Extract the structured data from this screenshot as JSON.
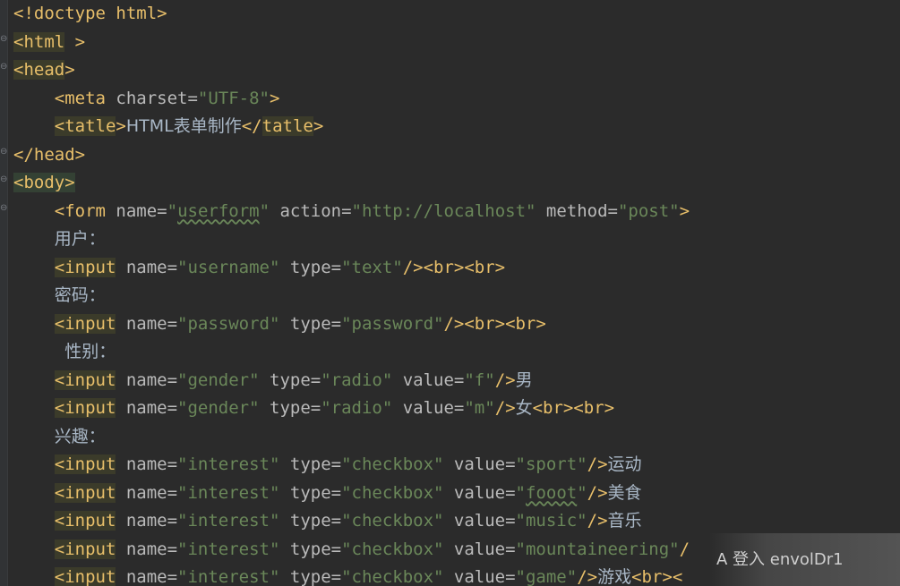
{
  "lines": [
    {
      "indent": "",
      "tokens": [
        {
          "c": "b",
          "t": "<!doctype html>"
        }
      ]
    },
    {
      "indent": "",
      "tokens": [
        {
          "c": "hl",
          "t": "<html"
        },
        {
          "c": "b",
          "t": " >"
        }
      ]
    },
    {
      "indent": "",
      "tokens": [
        {
          "c": "hl",
          "t": "<head"
        },
        {
          "c": "b",
          "t": ">"
        }
      ]
    },
    {
      "indent": "    ",
      "tokens": [
        {
          "c": "b",
          "t": "<meta"
        },
        {
          "c": "a",
          "t": " charset="
        },
        {
          "c": "s",
          "t": "\"UTF-8\""
        },
        {
          "c": "b",
          "t": ">"
        }
      ]
    },
    {
      "indent": "    ",
      "tokens": [
        {
          "c": "hl",
          "t": "<tatle"
        },
        {
          "c": "b",
          "t": ">"
        },
        {
          "c": "t cjk",
          "t": "HTML表单制作"
        },
        {
          "c": "b",
          "t": "</"
        },
        {
          "c": "hl",
          "t": "tatle"
        },
        {
          "c": "b",
          "t": ">"
        }
      ]
    },
    {
      "indent": "",
      "tokens": [
        {
          "c": "b",
          "t": "</head>"
        }
      ]
    },
    {
      "indent": "",
      "tokens": [
        {
          "c": "body-hl",
          "t": "<body>"
        }
      ]
    },
    {
      "indent": "    ",
      "tokens": [
        {
          "c": "b",
          "t": "<form"
        },
        {
          "c": "a",
          "t": " name="
        },
        {
          "c": "s",
          "t": "\""
        },
        {
          "c": "s typo",
          "t": "userform"
        },
        {
          "c": "s",
          "t": "\""
        },
        {
          "c": "a",
          "t": " action="
        },
        {
          "c": "s",
          "t": "\"http://localhost\""
        },
        {
          "c": "a",
          "t": " method="
        },
        {
          "c": "s",
          "t": "\"post\""
        },
        {
          "c": "b",
          "t": ">"
        }
      ]
    },
    {
      "indent": "    ",
      "tokens": [
        {
          "c": "t cjk",
          "t": "用户："
        }
      ]
    },
    {
      "indent": "    ",
      "tokens": [
        {
          "c": "hl",
          "t": "<input"
        },
        {
          "c": "a",
          "t": " name="
        },
        {
          "c": "s",
          "t": "\"username\""
        },
        {
          "c": "a",
          "t": " type="
        },
        {
          "c": "s",
          "t": "\"text\""
        },
        {
          "c": "b",
          "t": "/><br><br>"
        }
      ]
    },
    {
      "indent": "    ",
      "tokens": [
        {
          "c": "t cjk",
          "t": "密码："
        }
      ]
    },
    {
      "indent": "    ",
      "tokens": [
        {
          "c": "hl",
          "t": "<input"
        },
        {
          "c": "a",
          "t": " name="
        },
        {
          "c": "s",
          "t": "\"password\""
        },
        {
          "c": "a",
          "t": " type="
        },
        {
          "c": "s",
          "t": "\"password\""
        },
        {
          "c": "b",
          "t": "/><br><br>"
        }
      ]
    },
    {
      "indent": "     ",
      "tokens": [
        {
          "c": "t cjk",
          "t": "性别："
        }
      ]
    },
    {
      "indent": "    ",
      "tokens": [
        {
          "c": "hl",
          "t": "<input"
        },
        {
          "c": "a",
          "t": " name="
        },
        {
          "c": "s",
          "t": "\"gender\""
        },
        {
          "c": "a",
          "t": " type="
        },
        {
          "c": "s",
          "t": "\"radio\""
        },
        {
          "c": "a",
          "t": " value="
        },
        {
          "c": "s",
          "t": "\"f\""
        },
        {
          "c": "b",
          "t": "/>"
        },
        {
          "c": "t cjk",
          "t": "男"
        }
      ]
    },
    {
      "indent": "    ",
      "tokens": [
        {
          "c": "hl",
          "t": "<input"
        },
        {
          "c": "a",
          "t": " name="
        },
        {
          "c": "s",
          "t": "\"gender\""
        },
        {
          "c": "a",
          "t": " type="
        },
        {
          "c": "s",
          "t": "\"radio\""
        },
        {
          "c": "a",
          "t": " value="
        },
        {
          "c": "s",
          "t": "\"m\""
        },
        {
          "c": "b",
          "t": "/>"
        },
        {
          "c": "t cjk",
          "t": "女"
        },
        {
          "c": "b",
          "t": "<br><br>"
        }
      ]
    },
    {
      "indent": "    ",
      "tokens": [
        {
          "c": "t cjk",
          "t": "兴趣："
        }
      ]
    },
    {
      "indent": "    ",
      "tokens": [
        {
          "c": "hl",
          "t": "<input"
        },
        {
          "c": "a",
          "t": " name="
        },
        {
          "c": "s",
          "t": "\"interest\""
        },
        {
          "c": "a",
          "t": " type="
        },
        {
          "c": "s",
          "t": "\"checkbox\""
        },
        {
          "c": "a",
          "t": " value="
        },
        {
          "c": "s",
          "t": "\"sport\""
        },
        {
          "c": "b",
          "t": "/>"
        },
        {
          "c": "t cjk",
          "t": "运动"
        }
      ]
    },
    {
      "indent": "    ",
      "tokens": [
        {
          "c": "hl",
          "t": "<input"
        },
        {
          "c": "a",
          "t": " name="
        },
        {
          "c": "s",
          "t": "\"interest\""
        },
        {
          "c": "a",
          "t": " type="
        },
        {
          "c": "s",
          "t": "\"checkbox\""
        },
        {
          "c": "a",
          "t": " value="
        },
        {
          "c": "s",
          "t": "\""
        },
        {
          "c": "s typo",
          "t": "fooot"
        },
        {
          "c": "s",
          "t": "\""
        },
        {
          "c": "b",
          "t": "/>"
        },
        {
          "c": "t cjk",
          "t": "美食"
        }
      ]
    },
    {
      "indent": "    ",
      "tokens": [
        {
          "c": "hl",
          "t": "<input"
        },
        {
          "c": "a",
          "t": " name="
        },
        {
          "c": "s",
          "t": "\"interest\""
        },
        {
          "c": "a",
          "t": " type="
        },
        {
          "c": "s",
          "t": "\"checkbox\""
        },
        {
          "c": "a",
          "t": " value="
        },
        {
          "c": "s",
          "t": "\"music\""
        },
        {
          "c": "b",
          "t": "/>"
        },
        {
          "c": "t cjk",
          "t": "音乐"
        }
      ]
    },
    {
      "indent": "    ",
      "tokens": [
        {
          "c": "hl",
          "t": "<input"
        },
        {
          "c": "a",
          "t": " name="
        },
        {
          "c": "s",
          "t": "\"interest\""
        },
        {
          "c": "a",
          "t": " type="
        },
        {
          "c": "s",
          "t": "\"checkbox\""
        },
        {
          "c": "a",
          "t": " value="
        },
        {
          "c": "s",
          "t": "\"mountaineering\""
        },
        {
          "c": "b",
          "t": "/"
        }
      ]
    },
    {
      "indent": "    ",
      "tokens": [
        {
          "c": "hl",
          "t": "<input"
        },
        {
          "c": "a",
          "t": " name="
        },
        {
          "c": "s",
          "t": "\"interest\""
        },
        {
          "c": "a",
          "t": " type="
        },
        {
          "c": "s",
          "t": "\"checkbox\""
        },
        {
          "c": "a",
          "t": " value="
        },
        {
          "c": "s",
          "t": "\"game\""
        },
        {
          "c": "b",
          "t": "/>"
        },
        {
          "c": "t cjk",
          "t": "游戏"
        },
        {
          "c": "b",
          "t": "<br><"
        }
      ]
    }
  ],
  "overlay": {
    "text": "A 登入 envolDr1"
  }
}
